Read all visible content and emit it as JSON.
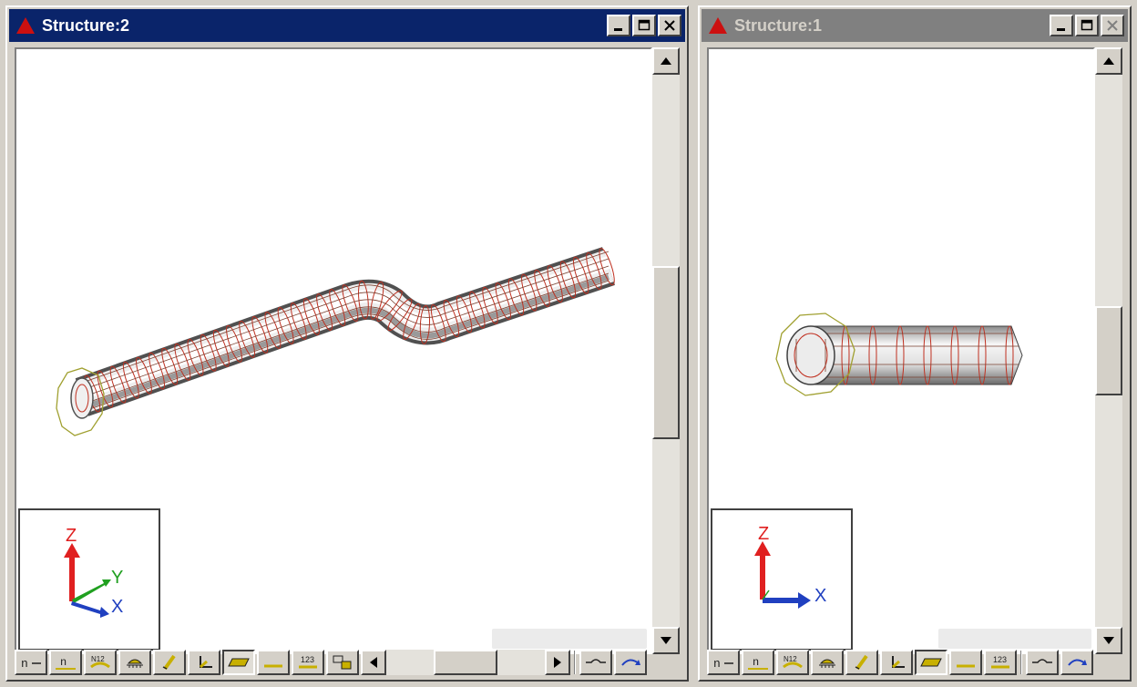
{
  "windows": {
    "structure2": {
      "title": "Structure:2",
      "active": true,
      "triad": {
        "z": "Z",
        "y": "Y",
        "x": "X"
      }
    },
    "structure1": {
      "title": "Structure:1",
      "active": false,
      "triad": {
        "z": "Z",
        "x": "X"
      }
    }
  },
  "toolbar_icons": [
    "node-number-icon",
    "node-label-icon",
    "element-number-icon",
    "load-icon",
    "boundary-icon",
    "coordinate-icon",
    "surface-shade-icon",
    "line-icon",
    "numbering-123-icon",
    "view-pan-icon",
    "wave-icon",
    "rotate-icon"
  ],
  "colors": {
    "active_title": "#0a246a",
    "inactive_title": "#808080",
    "axis_z": "#e02020",
    "axis_y": "#20a020",
    "axis_x": "#2040c0",
    "mesh_lines": "#c03020",
    "selection_ring": "#a0a030"
  }
}
